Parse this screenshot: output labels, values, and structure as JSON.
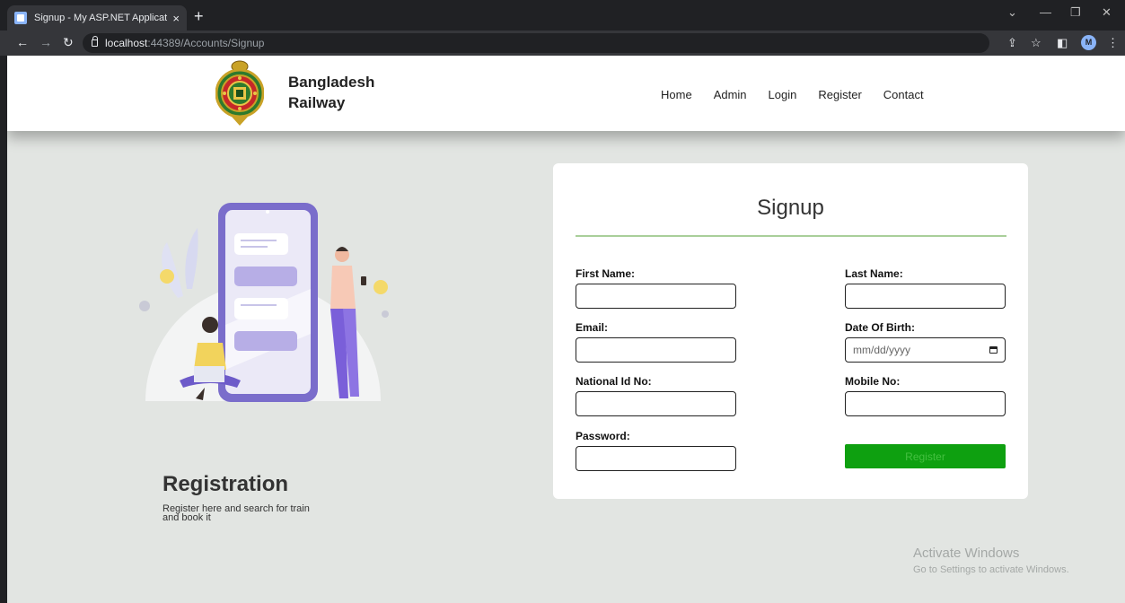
{
  "browser": {
    "tab_title": "Signup - My ASP.NET Application",
    "tab_close": "×",
    "new_tab": "+",
    "url_host": "localhost",
    "url_rest": ":44389/Accounts/Signup",
    "profile_initial": "M"
  },
  "header": {
    "brand_line1": "Bangladesh",
    "brand_line2": "Railway",
    "nav": [
      "Home",
      "Admin",
      "Login",
      "Register",
      "Contact"
    ]
  },
  "hero": {
    "title": "Registration",
    "description": "Register here and search for train and book it"
  },
  "form": {
    "title": "Signup",
    "first_name_label": "First Name:",
    "last_name_label": "Last Name:",
    "email_label": "Email:",
    "dob_label": "Date Of Birth:",
    "dob_placeholder": "mm/dd/yyyy",
    "nid_label": "National Id No:",
    "mobile_label": "Mobile No:",
    "password_label": "Password:",
    "submit_label": "Register"
  },
  "watermark": {
    "line1": "Activate Windows",
    "line2": "Go to Settings to activate Windows."
  },
  "colors": {
    "page_bg": "#e2e5e2",
    "button_green": "#0ea010",
    "divider_green": "#a9cf9a"
  }
}
